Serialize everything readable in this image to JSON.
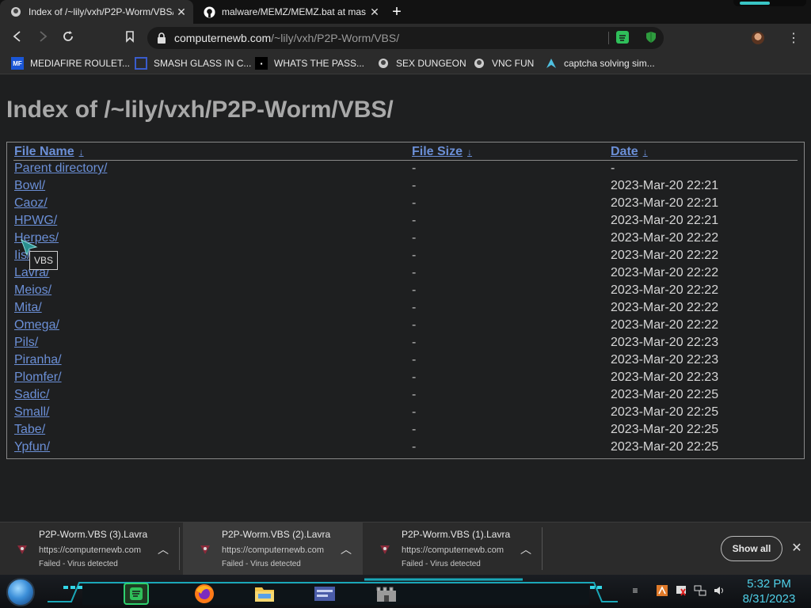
{
  "tabs": [
    {
      "title": "Index of /~lily/vxh/P2P-Worm/VBS/",
      "active": true,
      "favicon": "site-logo-icon"
    },
    {
      "title": "malware/MEMZ/MEMZ.bat at mas",
      "active": false,
      "favicon": "github-icon"
    }
  ],
  "toolbar": {
    "url_host": "computernewb.com",
    "url_path": "/~lily/vxh/P2P-Worm/VBS/"
  },
  "bookmarks": [
    {
      "label": "MEDIAFIRE ROULET...",
      "icon": "mediafire-icon"
    },
    {
      "label": "SMASH GLASS IN C...",
      "icon": "glass-icon"
    },
    {
      "label": "WHATS THE PASS...",
      "icon": "dark-site-icon"
    },
    {
      "label": "SEX DUNGEON",
      "icon": "site-logo-icon"
    },
    {
      "label": "VNC FUN",
      "icon": "site-logo-icon"
    },
    {
      "label": "captcha solving sim...",
      "icon": "arch-icon"
    }
  ],
  "page": {
    "title": "Index of /~lily/vxh/P2P-Worm/VBS/",
    "headers": {
      "name": "File Name",
      "size": "File Size",
      "date": "Date",
      "sort_arrow": "↓"
    },
    "rows": [
      {
        "name": "Parent directory/",
        "size": "-",
        "date": "-"
      },
      {
        "name": "Bowl/",
        "size": "-",
        "date": "2023-Mar-20 22:21"
      },
      {
        "name": "Caoz/",
        "size": "-",
        "date": "2023-Mar-20 22:21"
      },
      {
        "name": "HPWG/",
        "size": "-",
        "date": "2023-Mar-20 22:21"
      },
      {
        "name": "Herpes/",
        "size": "-",
        "date": "2023-Mar-20 22:22"
      },
      {
        "name": "Iis/",
        "size": "-",
        "date": "2023-Mar-20 22:22"
      },
      {
        "name": "Lavra/",
        "size": "-",
        "date": "2023-Mar-20 22:22"
      },
      {
        "name": "Meios/",
        "size": "-",
        "date": "2023-Mar-20 22:22"
      },
      {
        "name": "Mita/",
        "size": "-",
        "date": "2023-Mar-20 22:22"
      },
      {
        "name": "Omega/",
        "size": "-",
        "date": "2023-Mar-20 22:22"
      },
      {
        "name": "Pils/",
        "size": "-",
        "date": "2023-Mar-20 22:23"
      },
      {
        "name": "Piranha/",
        "size": "-",
        "date": "2023-Mar-20 22:23"
      },
      {
        "name": "Plomfer/",
        "size": "-",
        "date": "2023-Mar-20 22:23"
      },
      {
        "name": "Sadic/",
        "size": "-",
        "date": "2023-Mar-20 22:25"
      },
      {
        "name": "Small/",
        "size": "-",
        "date": "2023-Mar-20 22:25"
      },
      {
        "name": "Tabe/",
        "size": "-",
        "date": "2023-Mar-20 22:25"
      },
      {
        "name": "Ypfun/",
        "size": "-",
        "date": "2023-Mar-20 22:25"
      }
    ],
    "tooltip": "VBS"
  },
  "downloads": [
    {
      "name": "P2P-Worm.VBS (3).Lavra",
      "source": "https://computernewb.com",
      "status": "Failed - Virus detected"
    },
    {
      "name": "P2P-Worm.VBS (2).Lavra",
      "source": "https://computernewb.com",
      "status": "Failed - Virus detected"
    },
    {
      "name": "P2P-Worm.VBS (1).Lavra",
      "source": "https://computernewb.com",
      "status": "Failed - Virus detected"
    }
  ],
  "download_shelf": {
    "show_all": "Show all"
  },
  "taskbar": {
    "time": "5:32 PM",
    "date": "8/31/2023"
  },
  "colors": {
    "link": "#6b8fd6",
    "accent": "#39c5c5",
    "background": "#1e1f20"
  }
}
